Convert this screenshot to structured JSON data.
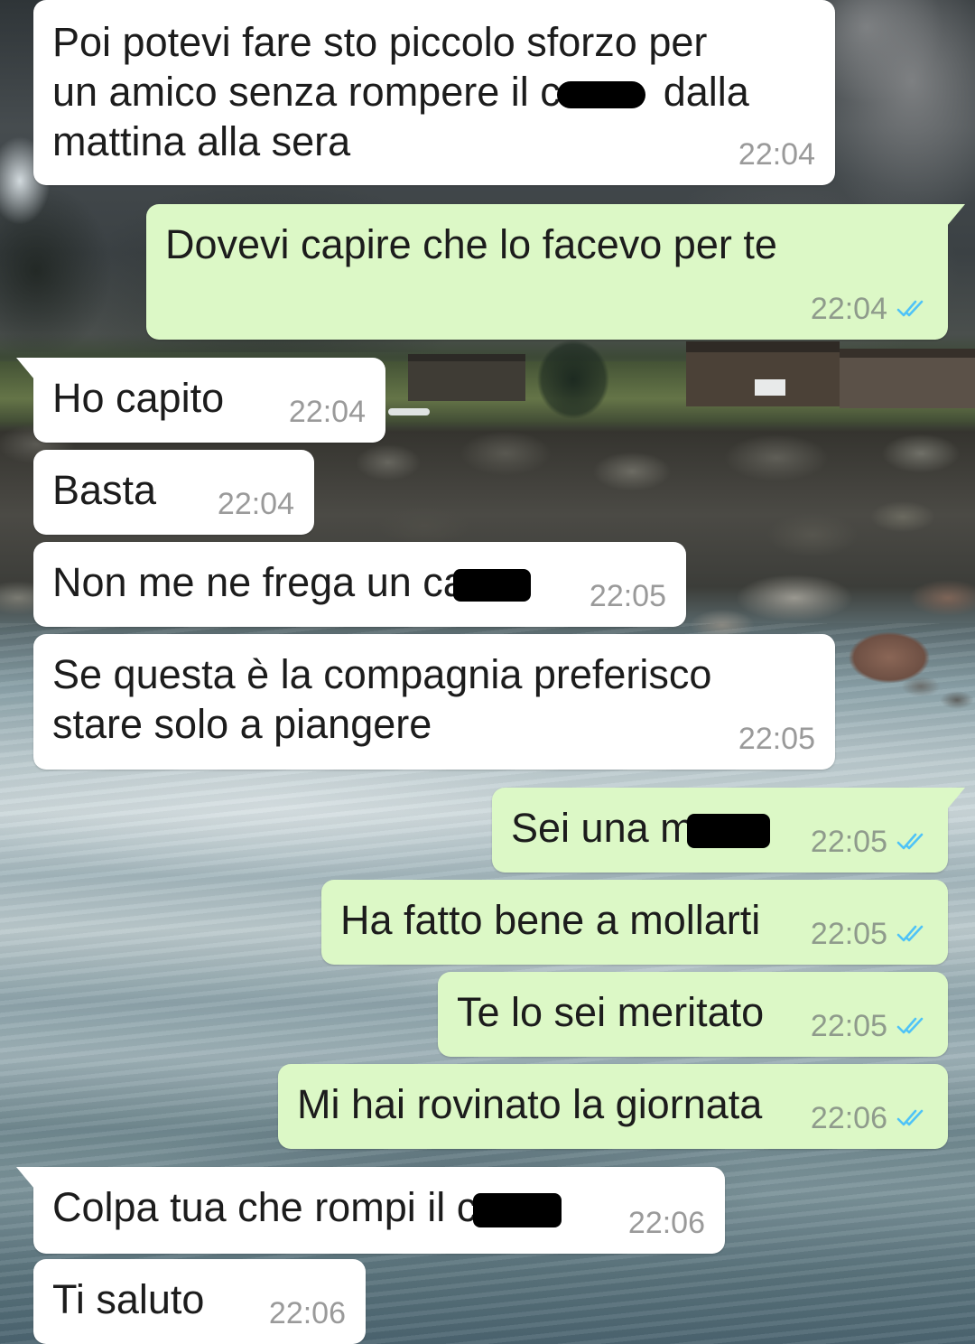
{
  "theme": {
    "incoming_bubble": "#ffffff",
    "outgoing_bubble": "#dcf8c6",
    "message_text": "#1c1c1c",
    "time_text_incoming": "#9a9a9a",
    "time_text_outgoing": "#8f9b8c",
    "read_tick": "#4fc3f7",
    "redaction": "#000000"
  },
  "messages": [
    {
      "outgoing": false,
      "text": [
        "Poi potevi fare sto piccolo sforzo per",
        "un amico senza rompere il c",
        "dalla",
        "mattina alla sera"
      ],
      "time": "22:04"
    },
    {
      "outgoing": true,
      "text": [
        "Dovevi capire che lo facevo per te"
      ],
      "time": "22:04",
      "status_icon": "double-check-icon"
    },
    {
      "outgoing": false,
      "text": [
        "Ho capito"
      ],
      "time": "22:04"
    },
    {
      "outgoing": false,
      "text": [
        "Basta"
      ],
      "time": "22:04"
    },
    {
      "outgoing": false,
      "text": [
        "Non me ne frega un ca"
      ],
      "time": "22:05"
    },
    {
      "outgoing": false,
      "text": [
        "Se questa è la compagnia preferisco",
        "stare solo a piangere"
      ],
      "time": "22:05"
    },
    {
      "outgoing": true,
      "text": [
        "Sei una m"
      ],
      "time": "22:05",
      "status_icon": "double-check-icon"
    },
    {
      "outgoing": true,
      "text": [
        "Ha fatto bene a mollarti"
      ],
      "time": "22:05",
      "status_icon": "double-check-icon"
    },
    {
      "outgoing": true,
      "text": [
        "Te lo sei meritato"
      ],
      "time": "22:05",
      "status_icon": "double-check-icon"
    },
    {
      "outgoing": true,
      "text": [
        "Mi hai rovinato la giornata"
      ],
      "time": "22:06",
      "status_icon": "double-check-icon"
    },
    {
      "outgoing": false,
      "text": [
        "Colpa tua che rompi il c"
      ],
      "time": "22:06"
    },
    {
      "outgoing": false,
      "text": [
        "Ti saluto"
      ],
      "time": "22:06"
    }
  ]
}
